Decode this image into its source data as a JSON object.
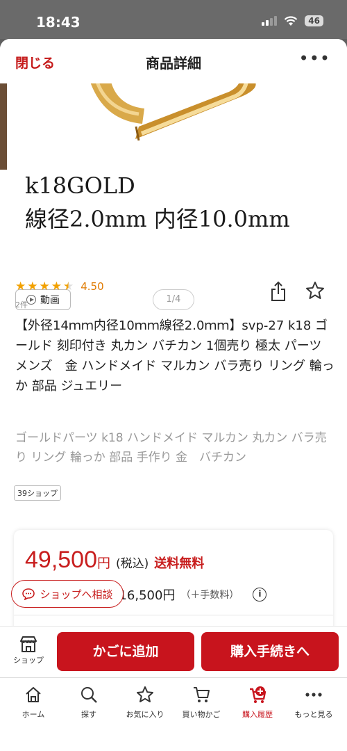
{
  "status_bar": {
    "time": "18:43",
    "battery": "46"
  },
  "header": {
    "close_label": "閉じる",
    "title": "商品詳細",
    "more_label": "•••"
  },
  "product": {
    "image_caption_1": "k18GOLD",
    "image_caption_2": "線径2.0mm 内径10.0mm",
    "video_label": "動画",
    "page_indicator": "1/4",
    "rating": 4.5,
    "rating_text": "4.50",
    "review_count": "2件",
    "title": "【外径14ｍｍ内径10ｍｍ線径2.0ｍｍ】svp-27 k18 ゴールド 刻印付き 丸カン バチカン 1個売り 極太 パーツ　メンズ　金 ハンドメイド マルカン バラ売り リング 輪っか 部品 ジュエリー",
    "tags": "ゴールドパーツ k18 ハンドメイド マルカン 丸カン バラ売り リング 輪っか 部品 手作り 金　バチカン",
    "shop_badge": "39ショップ"
  },
  "price": {
    "value": "49,500",
    "unit": "円",
    "tax_label": "(税込)",
    "shipping": "送料無料",
    "sub_price": "¥16,500円",
    "fee_note": "（＋手数料）",
    "info_icon": "i"
  },
  "consult": {
    "label": "ショップへ相談"
  },
  "actions": {
    "shop_label": "ショップ",
    "cart_label": "かごに追加",
    "buy_label": "購入手続きへ"
  },
  "tabs": [
    {
      "label": "ホーム",
      "icon": "home-icon"
    },
    {
      "label": "探す",
      "icon": "search-icon"
    },
    {
      "label": "お気に入り",
      "icon": "star-icon"
    },
    {
      "label": "買い物かご",
      "icon": "cart-icon"
    },
    {
      "label": "購入履歴",
      "icon": "purchase-history-icon"
    },
    {
      "label": "もっと見る",
      "icon": "more-icon"
    }
  ],
  "colors": {
    "brand_red": "#c8141d",
    "rating_orange": "#f2a100"
  }
}
